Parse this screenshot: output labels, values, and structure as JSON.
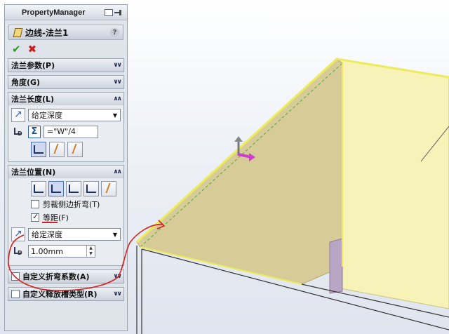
{
  "panel": {
    "title": "PropertyManager",
    "feature_name": "边线-法兰1",
    "help": "?",
    "ok": "✔",
    "cancel": "✖"
  },
  "groups": {
    "flange_params": "法兰参数(P)",
    "angle": "角度(G)",
    "flange_length": "法兰长度(L)",
    "flange_position": "法兰位置(N)",
    "custom_bend": "自定义折弯系数(A)",
    "custom_relief": "自定义释放槽类型(R)"
  },
  "length": {
    "end_condition": "给定深度",
    "equation": "=\"W\"/4"
  },
  "position": {
    "trim_side_bends": "剪裁侧边折弯(T)",
    "offset": "等距(F)",
    "offset_condition": "给定深度",
    "offset_value": "1.00mm"
  },
  "colors": {
    "flange_face": "#d7cc98",
    "side_face": "#f7f3b8",
    "edge_highlight": "#ecec5a",
    "annotation": "#d42020",
    "purple_face": "#b9a6c4"
  },
  "icons": [
    "flange-feature-icon",
    "help-icon",
    "ok-icon",
    "cancel-icon",
    "direction-arrow-icon",
    "dimension-icon",
    "sigma-icon",
    "flange-position-icon",
    "move-triad-icon",
    "pin-icon",
    "view-icon"
  ]
}
